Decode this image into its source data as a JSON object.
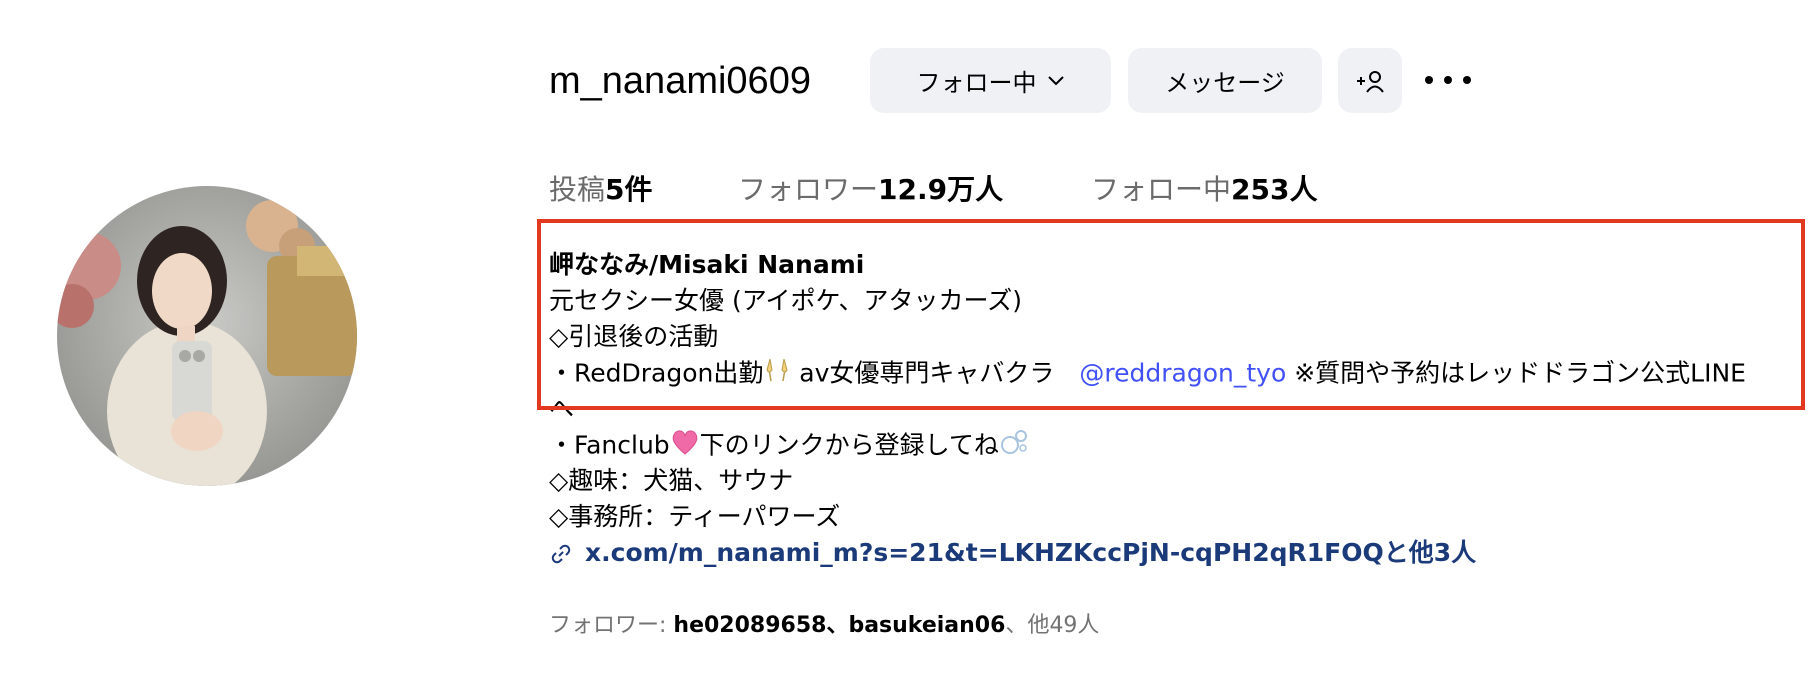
{
  "profile": {
    "username": "m_nanami0609",
    "avatar_icon": "profile-photo"
  },
  "actions": {
    "follow_label": "フォロー中",
    "message_label": "メッセージ",
    "add_user_icon": "add-user-icon",
    "more_icon": "more-horizontal-icon"
  },
  "stats": {
    "posts_label": "投稿",
    "posts_value": "5件",
    "followers_label": "フォロワー",
    "followers_value": "12.9万人",
    "following_label": "フォロー中",
    "following_value": "253人"
  },
  "bio": {
    "name": "岬ななみ/Misaki Nanami",
    "line1": "元セクシー女優 (アイポケ、アタッカーズ)",
    "line2": "◇引退後の活動",
    "line3_pre": "・RedDragon出勤",
    "line3_mid": " av女優専門キャバクラ　",
    "mention": "@reddragon_tyo",
    "line3_post": " ※質問や予約はレッドドラゴン公式LINE",
    "line3_wrap": "へ",
    "line4_pre": "・Fanclub",
    "line4_post": "下のリンクから登録してね",
    "line5": "◇趣味：犬猫、サウナ",
    "line6": "◇事務所：ティーパワーズ",
    "link": "x.com/m_nanami_m?s=21&t=LKHZKccPjN-cqPH2qR1FOQと他3人"
  },
  "followed_by": {
    "label": "フォロワー: ",
    "users": "he02089658、basukeian06",
    "others": "、他49人"
  },
  "colors": {
    "accent_link": "#4150f7",
    "link_dark": "#1b3a7a",
    "highlight": "#e2381f",
    "button_bg": "#eff1f5"
  }
}
